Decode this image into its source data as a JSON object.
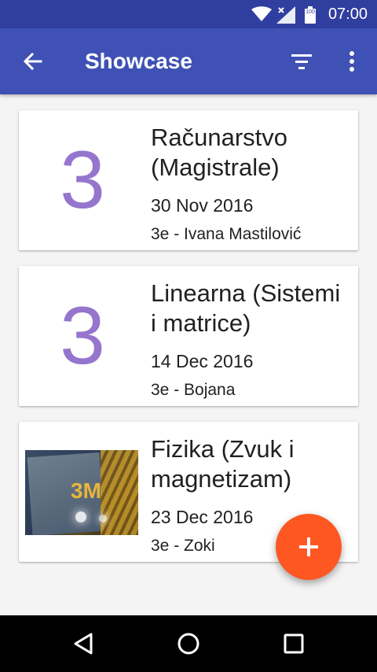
{
  "status_bar": {
    "time": "07:00",
    "battery_label": "100",
    "icons": [
      "wifi-icon",
      "signal-icon",
      "battery-icon"
    ]
  },
  "app_bar": {
    "title": "Showcase",
    "icons": [
      "back-arrow-icon",
      "filter-icon",
      "more-vert-icon"
    ],
    "color": "#3f51b5",
    "status_color": "#303f9f"
  },
  "cards": [
    {
      "thumb": "3",
      "title_line1": "Računarstvo",
      "title_line2": "(Magistrale)",
      "date": "30 Nov 2016",
      "grade": "3e - Ivana Mastilović"
    },
    {
      "thumb": "3",
      "title_line1": "Linearna (Sistemi",
      "title_line2": "i matrice)",
      "date": "14 Dec 2016",
      "grade": "3e - Bojana"
    },
    {
      "thumb_image": "textbook-photo",
      "photo_text": "3M",
      "title_line1": "Fizika (Zvuk i",
      "title_line2": "magnetizam)",
      "date": "23 Dec 2016",
      "grade": "3e - Zoki"
    }
  ],
  "fab": {
    "icon": "add-icon",
    "color": "#ff5722"
  },
  "nav_bar": {
    "icons": [
      "back-triangle-icon",
      "home-circle-icon",
      "recents-square-icon"
    ]
  },
  "accent_digit_color": "#9575cd"
}
